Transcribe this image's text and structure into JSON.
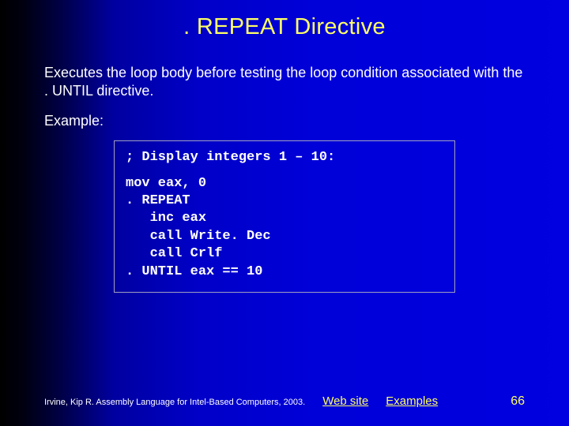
{
  "title": ". REPEAT Directive",
  "description": "Executes the loop body before testing the loop condition associated with the . UNTIL directive.",
  "example_label": "Example:",
  "code": {
    "comment": "; Display integers 1 – 10:",
    "body": "mov eax, 0\n. REPEAT\n   inc eax\n   call Write. Dec\n   call Crlf\n. UNTIL eax == 10"
  },
  "footer": {
    "credit": "Irvine, Kip R. Assembly Language for Intel-Based Computers, 2003.",
    "link1": "Web site",
    "link2": "Examples",
    "page": "66"
  }
}
